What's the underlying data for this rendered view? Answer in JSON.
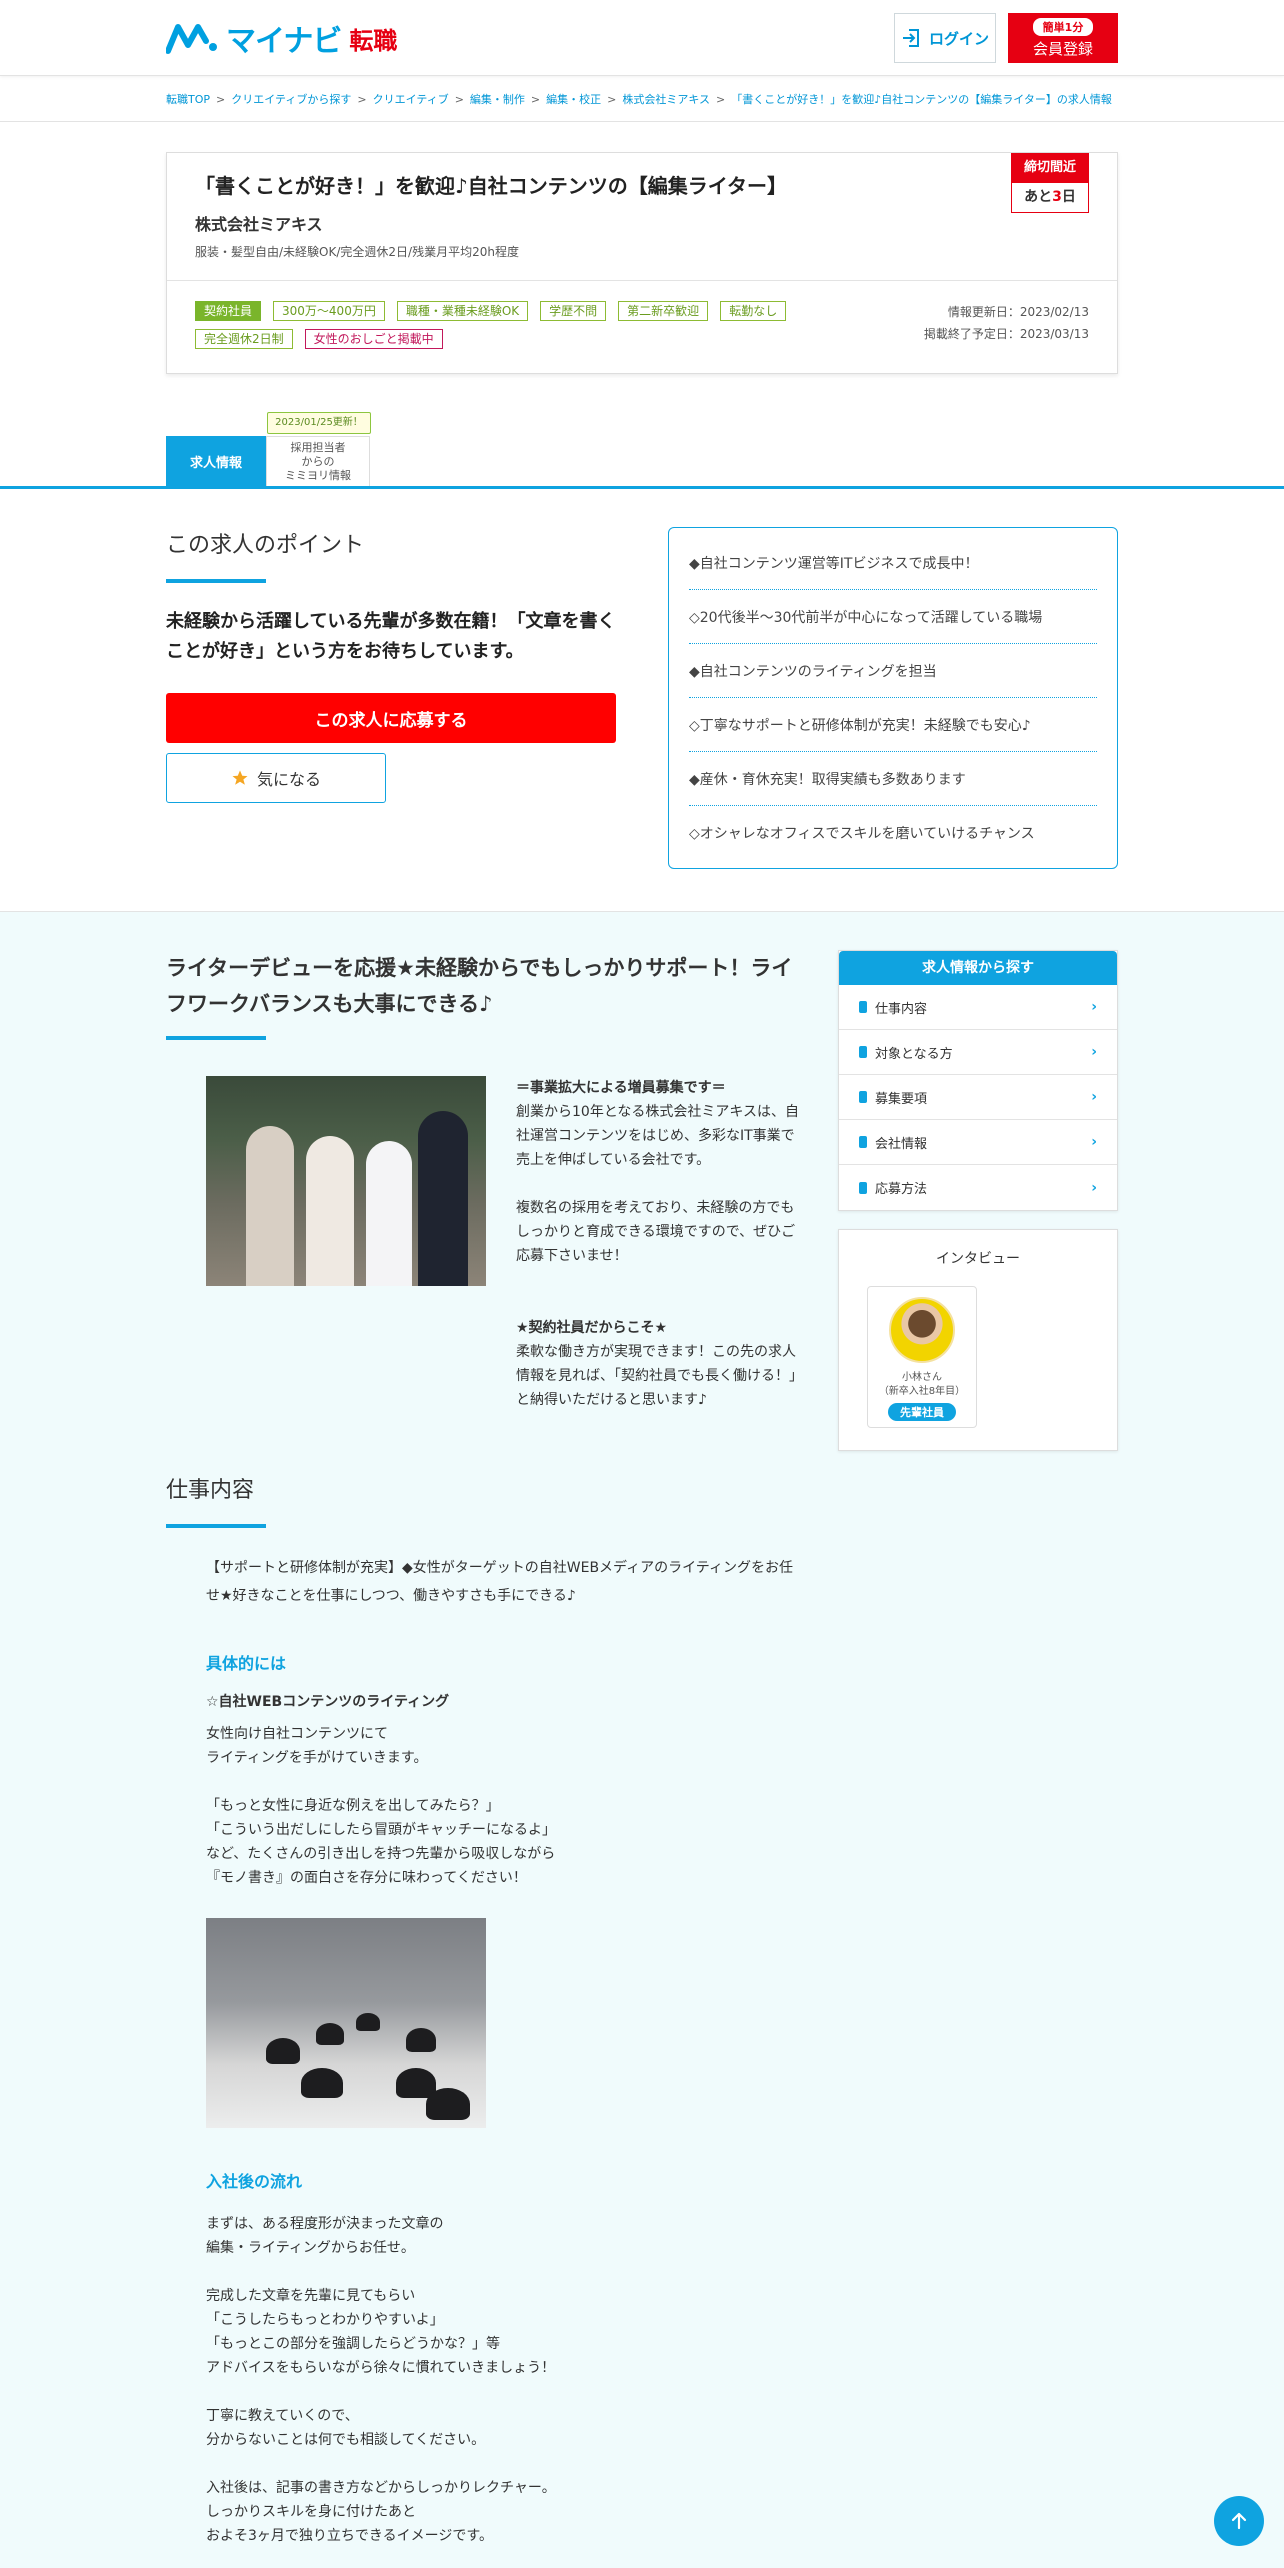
{
  "header": {
    "logo_text": "マイナビ",
    "logo_sub": "転職",
    "login_label": "ログイン",
    "register_pill": "簡単1分",
    "register_label": "会員登録"
  },
  "breadcrumb": [
    "転職TOP",
    "クリエイティブから探す",
    "クリエイティブ",
    "編集・制作",
    "編集・校正",
    "株式会社ミアキス",
    "「書くことが好き！」を歓迎♪自社コンテンツの【編集ライター】の求人情報"
  ],
  "job": {
    "title": "「書くことが好き！」を歓迎♪自社コンテンツの【編集ライター】",
    "company": "株式会社ミアキス",
    "subinfo": "服装・髪型自由/未経験OK/完全週休2日/残業月平均20h程度",
    "deadline_top": "締切間近",
    "deadline_pre": "あと",
    "deadline_num": "3",
    "deadline_post": "日",
    "tags": [
      {
        "label": "契約社員",
        "style": "filled"
      },
      {
        "label": "300万～400万円",
        "style": "normal"
      },
      {
        "label": "職種・業種未経験OK",
        "style": "normal"
      },
      {
        "label": "学歴不問",
        "style": "normal"
      },
      {
        "label": "第二新卒歓迎",
        "style": "normal"
      },
      {
        "label": "転勤なし",
        "style": "normal"
      },
      {
        "label": "完全週休2日制",
        "style": "normal"
      },
      {
        "label": "女性のおしごと掲載中",
        "style": "pink"
      }
    ],
    "updated": "情報更新日：2023/02/13",
    "end_date": "掲載終了予定日：2023/03/13"
  },
  "tabs": {
    "active": "求人情報",
    "update_badge": "2023/01/25更新！",
    "other_line1": "採用担当者",
    "other_line2": "からの",
    "other_line3": "ミミヨリ情報"
  },
  "points": {
    "title": "この求人のポイント",
    "lead": "未経験から活躍している先輩が多数在籍！「文章を書くことが好き」という方をお待ちしています。",
    "apply_label": "この求人に応募する",
    "fav_label": "気になる",
    "items": [
      "◆自社コンテンツ運営等ITビジネスで成長中！",
      "◇20代後半～30代前半が中心になって活躍している職場",
      "◆自社コンテンツのライティングを担当",
      "◇丁寧なサポートと研修体制が充実！未経験でも安心♪",
      "◆産休・育休充実！取得実績も多数あります",
      "◇オシャレなオフィスでスキルを磨いていけるチャンス"
    ]
  },
  "intro": {
    "title": "ライターデビューを応援★未経験からでもしっかりサポート！ライフワークバランスも大事にできる♪",
    "h1": "＝事業拡大による増員募集です＝",
    "p1": "創業から10年となる株式会社ミアキスは、自社運営コンテンツをはじめ、多彩なIT事業で売上を伸ばしている会社です。",
    "p2": "複数名の採用を考えており、未経験の方でもしっかりと育成できる環境ですので、ぜひご応募下さいませ！",
    "h2": "★契約社員だからこそ★",
    "p3": "柔軟な働き方が実現できます！この先の求人情報を見れば、「契約社員でも長く働ける！」と納得いただけると思います♪"
  },
  "job_content": {
    "title": "仕事内容",
    "lead": "【サポートと研修体制が充実】◆女性がターゲットの自社WEBメディアのライティングをお任せ★好きなことを仕事にしつつ、働きやすさも手にできる♪",
    "sub1": "具体的には",
    "sub1_bold": "☆自社WEBコンテンツのライティング",
    "sub1_body": "女性向け自社コンテンツにて\nライティングを手がけていきます。\n\n「もっと女性に身近な例えを出してみたら？」\n「こういう出だしにしたら冒頭がキャッチーになるよ」\nなど、たくさんの引き出しを持つ先輩から吸収しながら\n『モノ書き』の面白さを存分に味わってください！",
    "sub2": "入社後の流れ",
    "sub2_body": "まずは、ある程度形が決まった文章の\n編集・ライティングからお任せ。\n\n完成した文章を先輩に見てもらい\n「こうしたらもっとわかりやすいよ」\n「もっとこの部分を強調したらどうかな？」等\nアドバイスをもらいながら徐々に慣れていきましょう！\n\n丁寧に教えていくので、\n分からないことは何でも相談してください。\n\n入社後は、記事の書き方などからしっかりレクチャー。\nしっかりスキルを身に付けたあと\nおよそ3ヶ月で独り立ちできるイメージです。"
  },
  "sidebar": {
    "head": "求人情報から探す",
    "items": [
      "仕事内容",
      "対象となる方",
      "募集要項",
      "会社情報",
      "応募方法"
    ],
    "interview_title": "インタビュー",
    "iv_name1": "小林さん",
    "iv_name2": "（新卒入社8年目）",
    "iv_badge": "先輩社員"
  },
  "colors": {
    "accent": "#0fa3e0",
    "apply": "#ff0000",
    "brand_red": "#e60012"
  }
}
